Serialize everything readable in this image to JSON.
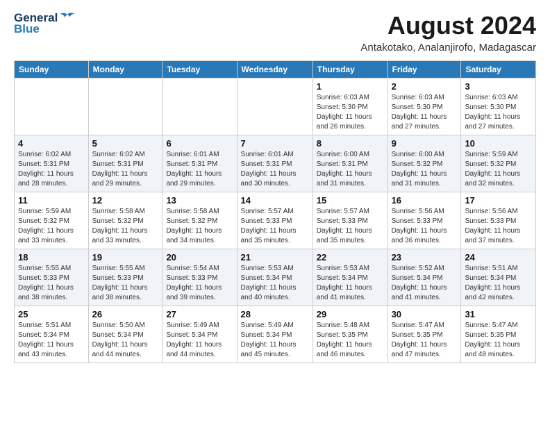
{
  "header": {
    "logo_general": "General",
    "logo_blue": "Blue",
    "title": "August 2024",
    "location": "Antakotako, Analanjirofo, Madagascar"
  },
  "weekdays": [
    "Sunday",
    "Monday",
    "Tuesday",
    "Wednesday",
    "Thursday",
    "Friday",
    "Saturday"
  ],
  "weeks": [
    [
      {
        "day": "",
        "info": ""
      },
      {
        "day": "",
        "info": ""
      },
      {
        "day": "",
        "info": ""
      },
      {
        "day": "",
        "info": ""
      },
      {
        "day": "1",
        "info": "Sunrise: 6:03 AM\nSunset: 5:30 PM\nDaylight: 11 hours\nand 26 minutes."
      },
      {
        "day": "2",
        "info": "Sunrise: 6:03 AM\nSunset: 5:30 PM\nDaylight: 11 hours\nand 27 minutes."
      },
      {
        "day": "3",
        "info": "Sunrise: 6:03 AM\nSunset: 5:30 PM\nDaylight: 11 hours\nand 27 minutes."
      }
    ],
    [
      {
        "day": "4",
        "info": "Sunrise: 6:02 AM\nSunset: 5:31 PM\nDaylight: 11 hours\nand 28 minutes."
      },
      {
        "day": "5",
        "info": "Sunrise: 6:02 AM\nSunset: 5:31 PM\nDaylight: 11 hours\nand 29 minutes."
      },
      {
        "day": "6",
        "info": "Sunrise: 6:01 AM\nSunset: 5:31 PM\nDaylight: 11 hours\nand 29 minutes."
      },
      {
        "day": "7",
        "info": "Sunrise: 6:01 AM\nSunset: 5:31 PM\nDaylight: 11 hours\nand 30 minutes."
      },
      {
        "day": "8",
        "info": "Sunrise: 6:00 AM\nSunset: 5:31 PM\nDaylight: 11 hours\nand 31 minutes."
      },
      {
        "day": "9",
        "info": "Sunrise: 6:00 AM\nSunset: 5:32 PM\nDaylight: 11 hours\nand 31 minutes."
      },
      {
        "day": "10",
        "info": "Sunrise: 5:59 AM\nSunset: 5:32 PM\nDaylight: 11 hours\nand 32 minutes."
      }
    ],
    [
      {
        "day": "11",
        "info": "Sunrise: 5:59 AM\nSunset: 5:32 PM\nDaylight: 11 hours\nand 33 minutes."
      },
      {
        "day": "12",
        "info": "Sunrise: 5:58 AM\nSunset: 5:32 PM\nDaylight: 11 hours\nand 33 minutes."
      },
      {
        "day": "13",
        "info": "Sunrise: 5:58 AM\nSunset: 5:32 PM\nDaylight: 11 hours\nand 34 minutes."
      },
      {
        "day": "14",
        "info": "Sunrise: 5:57 AM\nSunset: 5:33 PM\nDaylight: 11 hours\nand 35 minutes."
      },
      {
        "day": "15",
        "info": "Sunrise: 5:57 AM\nSunset: 5:33 PM\nDaylight: 11 hours\nand 35 minutes."
      },
      {
        "day": "16",
        "info": "Sunrise: 5:56 AM\nSunset: 5:33 PM\nDaylight: 11 hours\nand 36 minutes."
      },
      {
        "day": "17",
        "info": "Sunrise: 5:56 AM\nSunset: 5:33 PM\nDaylight: 11 hours\nand 37 minutes."
      }
    ],
    [
      {
        "day": "18",
        "info": "Sunrise: 5:55 AM\nSunset: 5:33 PM\nDaylight: 11 hours\nand 38 minutes."
      },
      {
        "day": "19",
        "info": "Sunrise: 5:55 AM\nSunset: 5:33 PM\nDaylight: 11 hours\nand 38 minutes."
      },
      {
        "day": "20",
        "info": "Sunrise: 5:54 AM\nSunset: 5:33 PM\nDaylight: 11 hours\nand 39 minutes."
      },
      {
        "day": "21",
        "info": "Sunrise: 5:53 AM\nSunset: 5:34 PM\nDaylight: 11 hours\nand 40 minutes."
      },
      {
        "day": "22",
        "info": "Sunrise: 5:53 AM\nSunset: 5:34 PM\nDaylight: 11 hours\nand 41 minutes."
      },
      {
        "day": "23",
        "info": "Sunrise: 5:52 AM\nSunset: 5:34 PM\nDaylight: 11 hours\nand 41 minutes."
      },
      {
        "day": "24",
        "info": "Sunrise: 5:51 AM\nSunset: 5:34 PM\nDaylight: 11 hours\nand 42 minutes."
      }
    ],
    [
      {
        "day": "25",
        "info": "Sunrise: 5:51 AM\nSunset: 5:34 PM\nDaylight: 11 hours\nand 43 minutes."
      },
      {
        "day": "26",
        "info": "Sunrise: 5:50 AM\nSunset: 5:34 PM\nDaylight: 11 hours\nand 44 minutes."
      },
      {
        "day": "27",
        "info": "Sunrise: 5:49 AM\nSunset: 5:34 PM\nDaylight: 11 hours\nand 44 minutes."
      },
      {
        "day": "28",
        "info": "Sunrise: 5:49 AM\nSunset: 5:34 PM\nDaylight: 11 hours\nand 45 minutes."
      },
      {
        "day": "29",
        "info": "Sunrise: 5:48 AM\nSunset: 5:35 PM\nDaylight: 11 hours\nand 46 minutes."
      },
      {
        "day": "30",
        "info": "Sunrise: 5:47 AM\nSunset: 5:35 PM\nDaylight: 11 hours\nand 47 minutes."
      },
      {
        "day": "31",
        "info": "Sunrise: 5:47 AM\nSunset: 5:35 PM\nDaylight: 11 hours\nand 48 minutes."
      }
    ]
  ]
}
